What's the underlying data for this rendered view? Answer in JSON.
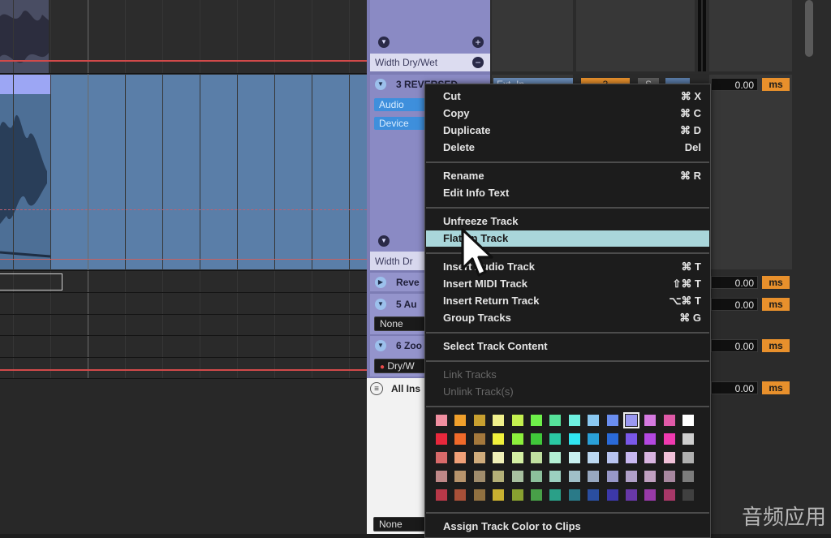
{
  "tracks": {
    "top_label": "Width Dry/Wet",
    "track3_title": "3 REVERSED",
    "track3_chip_audio": "Audio",
    "track3_chip_device": "Device",
    "track3_width_label": "Width Dr",
    "track_reverb_title": "Reve",
    "track5_title": "5 Au",
    "track5_input": "None",
    "track6_title": "6 Zoo",
    "track6_param": "Dry/W",
    "browser_label": "All Ins",
    "bottom_input": "None"
  },
  "mixer": {
    "ext_in_label": "Ext. In",
    "orange_value": "3",
    "s_button": "S",
    "rows": [
      {
        "value": "0.00",
        "unit": "ms"
      },
      {
        "value": "0.00",
        "unit": "ms"
      },
      {
        "value": "0.00",
        "unit": "ms"
      },
      {
        "value": "0.00",
        "unit": "ms"
      },
      {
        "value": "0.00",
        "unit": "ms"
      }
    ]
  },
  "context_menu": {
    "groups": [
      [
        {
          "label": "Cut",
          "shortcut": "⌘ X"
        },
        {
          "label": "Copy",
          "shortcut": "⌘ C"
        },
        {
          "label": "Duplicate",
          "shortcut": "⌘ D"
        },
        {
          "label": "Delete",
          "shortcut": "Del"
        }
      ],
      [
        {
          "label": "Rename",
          "shortcut": "⌘ R"
        },
        {
          "label": "Edit Info Text",
          "shortcut": ""
        }
      ],
      [
        {
          "label": "Unfreeze Track",
          "shortcut": ""
        },
        {
          "label": "Flatten Track",
          "shortcut": "",
          "highlighted": true
        }
      ],
      [
        {
          "label": "Insert Audio Track",
          "shortcut": "⌘ T"
        },
        {
          "label": "Insert MIDI Track",
          "shortcut": "⇧⌘ T"
        },
        {
          "label": "Insert Return Track",
          "shortcut": "⌥⌘ T"
        },
        {
          "label": "Group Tracks",
          "shortcut": "⌘ G"
        }
      ],
      [
        {
          "label": "Select Track Content",
          "shortcut": ""
        }
      ],
      [
        {
          "label": "Link Tracks",
          "shortcut": "",
          "disabled": true
        },
        {
          "label": "Unlink Track(s)",
          "shortcut": "",
          "disabled": true
        }
      ]
    ],
    "color_palette": [
      [
        "#f08fa0",
        "#f0a02c",
        "#c8a030",
        "#f0f08c",
        "#c4f050",
        "#6ef04a",
        "#56e29a",
        "#6ef0e0",
        "#8ac8f0",
        "#6a8ef0",
        "#9a98f0",
        "#d67ae0",
        "#e05aa8",
        "#ffffff"
      ],
      [
        "#e8283c",
        "#f06a2a",
        "#a4783c",
        "#f0f03c",
        "#8cf03c",
        "#40c83a",
        "#2ac8a2",
        "#30e4f0",
        "#2aa0d8",
        "#2a6ad8",
        "#7a58e8",
        "#b448e0",
        "#f03ab0",
        "#cecece"
      ],
      [
        "#d86a6a",
        "#f0a078",
        "#d0ac7c",
        "#f0f0b8",
        "#d4f0a4",
        "#c0e0a0",
        "#b4f0d4",
        "#c8f0f0",
        "#bcd8f0",
        "#b8c4f0",
        "#c8b8f0",
        "#d8b4e0",
        "#f0c0d8",
        "#b0b0b0"
      ],
      [
        "#c08888",
        "#b8946c",
        "#a08c6c",
        "#b4b078",
        "#a8c0a0",
        "#8cc09c",
        "#9cd0c0",
        "#a0c0c8",
        "#98a8c0",
        "#9898c8",
        "#b0a0c8",
        "#c0a0c0",
        "#a888a0",
        "#7c7c7c"
      ],
      [
        "#b83848",
        "#a85038",
        "#907040",
        "#c8b030",
        "#88a030",
        "#48a048",
        "#2aa088",
        "#2a7a88",
        "#2a4ea0",
        "#3c38a8",
        "#6838a8",
        "#983aa8",
        "#a83868",
        "#404040"
      ]
    ],
    "selected_color": "#9a98f0",
    "assign_color_label": "Assign Track Color to Clips"
  },
  "watermark": "音频应用"
}
